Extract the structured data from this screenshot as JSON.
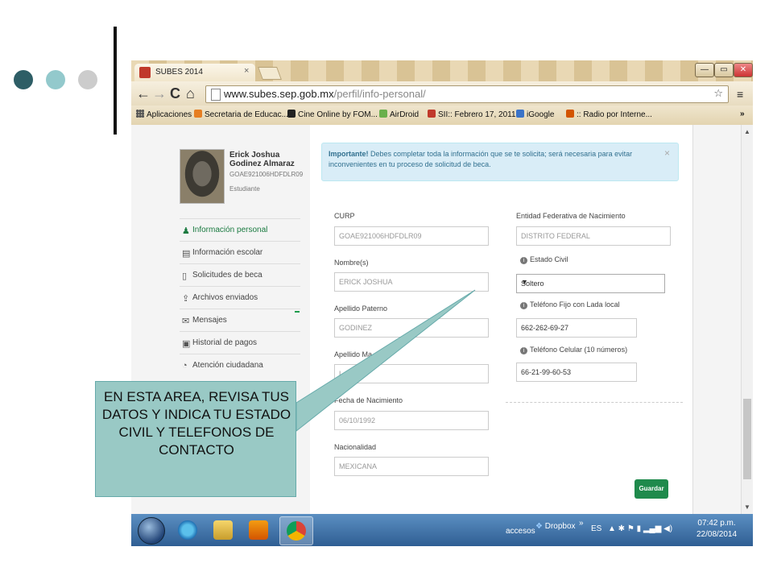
{
  "slide": {
    "dots": [
      {
        "color": "#2e5e66"
      },
      {
        "color": "#93c9cc"
      },
      {
        "color": "#cccccc"
      }
    ]
  },
  "browser": {
    "tab_title": "SUBES 2014",
    "tab_close": "×",
    "window_controls": {
      "minimize": "—",
      "restore": "▭",
      "close": "✕"
    },
    "address_domain": "www.subes.sep.gob.mx",
    "address_path": "/perfil/info-personal/",
    "nav": {
      "back": "←",
      "forward": "→",
      "reload": "C",
      "home": "⌂"
    },
    "star": "☆",
    "menu": "≡",
    "bookmarks": [
      {
        "label": "Aplicaciones",
        "color": "#555"
      },
      {
        "label": "Secretaria de Educac...",
        "color": "#e67e22"
      },
      {
        "label": "Cine Online by FOM...",
        "color": "#222"
      },
      {
        "label": "AirDroid",
        "color": "#6ab04c"
      },
      {
        "label": "SII:: Febrero 17, 2011...",
        "color": "#c0392b"
      },
      {
        "label": "iGoogle",
        "color": "#3b73c8"
      },
      {
        "label": ":: Radio por Interne...",
        "color": "#d35400"
      }
    ],
    "more": "»"
  },
  "profile": {
    "name": "Erick Joshua Godinez Almaraz",
    "curp": "GOAE921006HDFDLR09",
    "role": "Estudiante"
  },
  "sidebar": {
    "items": [
      {
        "label": "Información personal",
        "icon": "user-icon",
        "glyph": "♟",
        "active": true
      },
      {
        "label": "Información escolar",
        "icon": "book-icon",
        "glyph": "▤"
      },
      {
        "label": "Solicitudes de beca",
        "icon": "document-icon",
        "glyph": "▯"
      },
      {
        "label": "Archivos enviados",
        "icon": "upload-icon",
        "glyph": "⇪"
      },
      {
        "label": "Mensajes",
        "icon": "envelope-icon",
        "glyph": "✉"
      },
      {
        "label": "Historial de pagos",
        "icon": "receipt-icon",
        "glyph": "▣"
      },
      {
        "label": "Atención ciudadana",
        "icon": "chat-icon",
        "glyph": "◔"
      }
    ]
  },
  "alert": {
    "strong": "Importante!",
    "text": " Debes completar toda la información que se te solicita; será necesaria para evitar inconvenientes en tu proceso de solicitud de beca.",
    "close": "×"
  },
  "form": {
    "curp": {
      "label": "CURP",
      "value": "GOAE921006HDFDLR09"
    },
    "nombre": {
      "label": "Nombre(s)",
      "value": "ERICK JOSHUA"
    },
    "paterno": {
      "label": "Apellido Paterno",
      "value": "GODINEZ"
    },
    "materno": {
      "label": "Apellido Ma",
      "value": "L"
    },
    "nacimiento": {
      "label": "Fecha de Nacimiento",
      "value": "06/10/1992"
    },
    "nacionalidad": {
      "label": "Nacionalidad",
      "value": "MEXICANA"
    },
    "entidad": {
      "label": "Entidad Federativa de Nacimiento",
      "value": "DISTRITO FEDERAL"
    },
    "estado_civil": {
      "label": "Estado Civil",
      "value": "Soltero",
      "arrow": "▼"
    },
    "tel_fijo": {
      "label": "Teléfono Fijo con Lada local",
      "value": "662-262-69-27"
    },
    "tel_celular": {
      "label": "Teléfono Celular (10 números)",
      "value": "66-21-99-60-53"
    },
    "save_label": "Guardar",
    "info_glyph": "i"
  },
  "taskbar": {
    "accesos": "accesos",
    "dropbox": "Dropbox",
    "chev": "»",
    "lang": "ES",
    "tray_icons": "▲ ✱ ⚑ ▮ ▂▄▆ ◀)",
    "time": "07:42 p.m.",
    "date": "22/08/2014"
  },
  "callout": {
    "text": "EN ESTA AREA, REVISA TUS DATOS Y INDICA TU ESTADO CIVIL Y TELEFONOS DE CONTACTO",
    "color": "#99c9c5"
  }
}
